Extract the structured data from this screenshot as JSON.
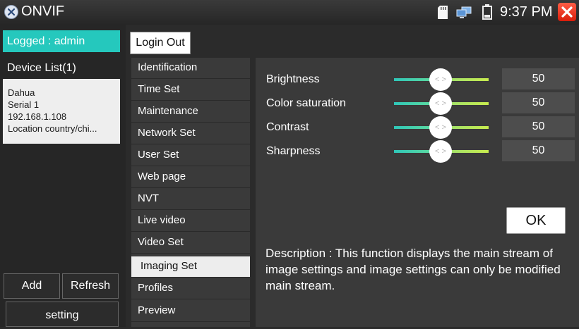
{
  "titlebar": {
    "app_title": "ONVIF",
    "time": "9:37 PM",
    "icons": [
      "onvif-logo-icon",
      "sd-card-icon",
      "network-icon",
      "battery-icon",
      "close-icon"
    ]
  },
  "left": {
    "logged_label": "Logged : admin",
    "device_list_label": "Device List(1)",
    "device": {
      "name": "Dahua",
      "serial": "Serial 1",
      "ip": "192.168.1.108",
      "location": "Location country/chi..."
    },
    "add_label": "Add",
    "refresh_label": "Refresh",
    "setting_label": "setting"
  },
  "header": {
    "login_out_label": "Login Out"
  },
  "menu": {
    "items": [
      {
        "label": "Identification"
      },
      {
        "label": "Time Set"
      },
      {
        "label": "Maintenance"
      },
      {
        "label": "Network Set"
      },
      {
        "label": "User Set"
      },
      {
        "label": "Web page"
      },
      {
        "label": "NVT"
      },
      {
        "label": "Live video"
      },
      {
        "label": "Video Set"
      },
      {
        "label": "Imaging Set"
      },
      {
        "label": "Profiles"
      },
      {
        "label": "Preview"
      }
    ],
    "active": "Imaging Set"
  },
  "imaging": {
    "thumb_glyph": "< >",
    "rows": [
      {
        "label": "Brightness",
        "value": "50"
      },
      {
        "label": "Color saturation",
        "value": "50"
      },
      {
        "label": "Contrast",
        "value": "50"
      },
      {
        "label": "Sharpness",
        "value": "50"
      }
    ],
    "ok_label": "OK",
    "description": "Description : This function displays the main stream of image settings and image settings can only be modified main stream."
  },
  "colors": {
    "accent": "#25c8bd",
    "close": "#e5321c",
    "panel": "#3a3a3a"
  }
}
